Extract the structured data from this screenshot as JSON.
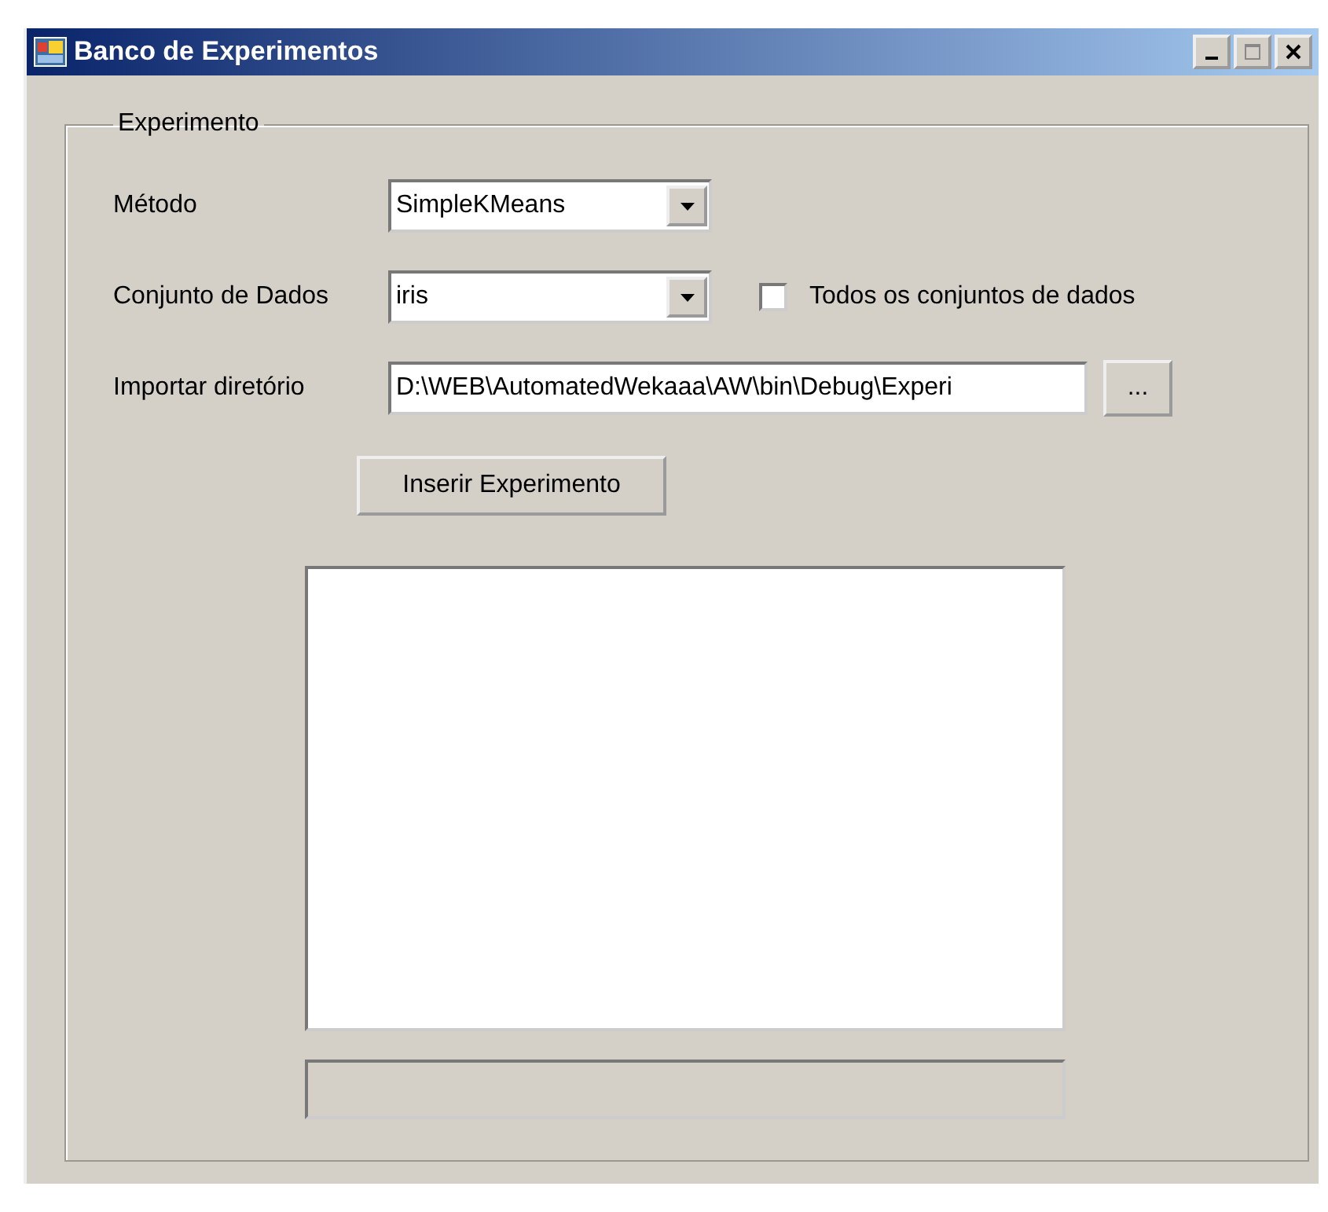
{
  "window": {
    "title": "Banco de Experimentos"
  },
  "group": {
    "label": "Experimento"
  },
  "method": {
    "label": "Método",
    "value": "SimpleKMeans"
  },
  "dataset": {
    "label": "Conjunto de Dados",
    "value": "iris"
  },
  "all_datasets": {
    "label": "Todos os conjuntos de dados",
    "checked": false
  },
  "import_dir": {
    "label": "Importar diretório",
    "value": "D:\\WEB\\AutomatedWekaaa\\AW\\bin\\Debug\\Experi",
    "browse": "..."
  },
  "insert_button": "Inserir Experimento"
}
